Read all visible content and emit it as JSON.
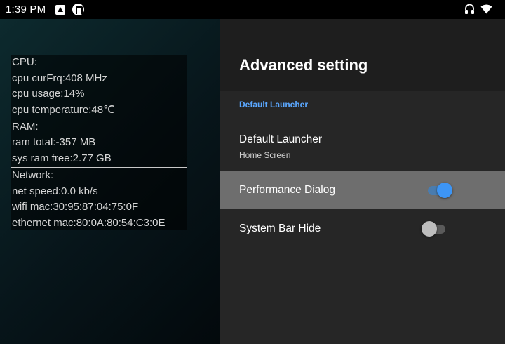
{
  "status_bar": {
    "time": "1:39 PM",
    "left_icons": [
      "app-a-icon",
      "notification-p-icon"
    ],
    "right_icons": [
      "headset-icon",
      "wifi-icon"
    ]
  },
  "perf_overlay": {
    "cpu_header": "CPU:",
    "cpu_freq": "cpu curFrq:408 MHz",
    "cpu_usage": "cpu usage:14%",
    "cpu_temp": "cpu temperature:48℃",
    "ram_header": "RAM:",
    "ram_total": "ram total:-357 MB",
    "ram_free": "sys ram free:2.77 GB",
    "net_header": "Network:",
    "net_speed": "net speed:0.0 kb/s",
    "wifi_mac": "wifi mac:30:95:87:04:75:0F",
    "eth_mac": "ethernet mac:80:0A:80:54:C3:0E"
  },
  "settings": {
    "title": "Advanced setting",
    "category": "Default Launcher",
    "items": [
      {
        "title": "Default Launcher",
        "summary": "Home Screen"
      },
      {
        "title": "Performance Dialog",
        "checked": true
      },
      {
        "title": "System Bar Hide",
        "checked": false
      }
    ]
  },
  "colors": {
    "accent": "#3d95f5",
    "category": "#5aa7ff",
    "highlight_row": "#6e6e6e",
    "panel_bg": "#262626"
  }
}
